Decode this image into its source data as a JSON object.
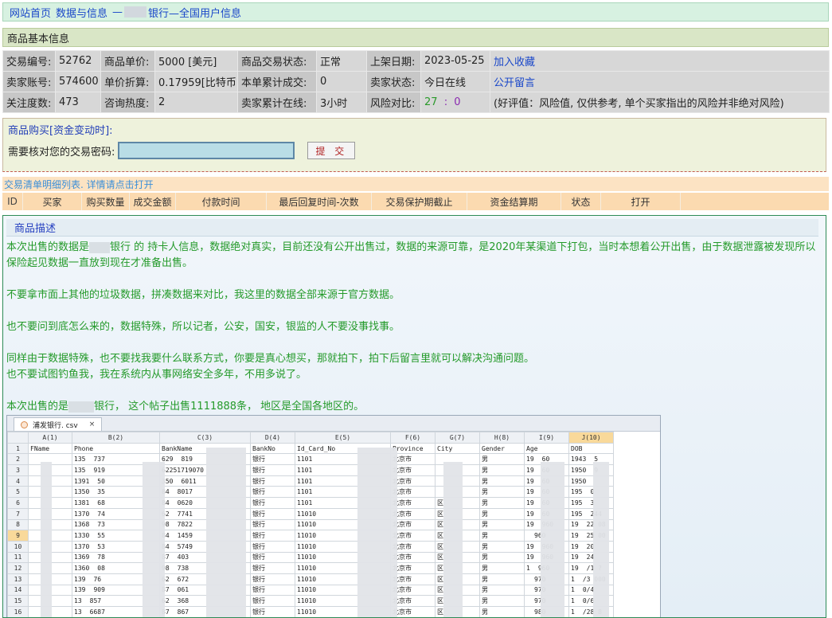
{
  "breadcrumb": {
    "home": "网站首页",
    "section": "数据与信息",
    "sep": "—",
    "title_suffix": "银行—全国用户信息"
  },
  "basic_info": {
    "heading": "商品基本信息",
    "rows": [
      [
        {
          "label": "交易编号:",
          "value": "52762"
        },
        {
          "label": "商品单价:",
          "value": "5000 [美元]"
        },
        {
          "label": "商品交易状态:",
          "value": "正常"
        },
        {
          "label": "上架日期:",
          "value": "2023-05-25"
        },
        {
          "link": "加入收藏"
        }
      ],
      [
        {
          "label": "卖家账号:",
          "value": "574600"
        },
        {
          "label": "单价折算:",
          "value": "0.17959[比特币]"
        },
        {
          "label": "本单累计成交:",
          "value": "0"
        },
        {
          "label": "卖家状态:",
          "value": "今日在线"
        },
        {
          "link": "公开留言"
        }
      ],
      [
        {
          "label": "关注度数:",
          "value": "473"
        },
        {
          "label": "咨询热度:",
          "value": "2"
        },
        {
          "label": "卖家累计在线:",
          "value": "3小时"
        },
        {
          "label": "风险对比:",
          "value_a": "27",
          "value_sep": ":",
          "value_b": "0"
        },
        {
          "note": "(好评值：风险值, 仅供参考, 单个买家指出的风险并非绝对风险)"
        }
      ]
    ]
  },
  "purchase": {
    "title": "商品购买[资金变动时]:",
    "password_label": "需要核对您的交易密码:",
    "password_value": "",
    "submit_label": "提 交"
  },
  "orders": {
    "title": "交易清单明细列表. 详情请点击打开",
    "columns": [
      "ID",
      "买家",
      "购买数量",
      "成交金额",
      "付款时间",
      "最后回复时间-次数",
      "交易保护期截止",
      "资金结算期",
      "状态",
      "打开"
    ]
  },
  "description": {
    "tag": "商品描述",
    "paragraphs": [
      "本次出售的数据是",
      "银行 的 持卡人信息，数据绝对真实，目前还没有公开出售过，数据的来源可靠，是2020年某渠道下打包，当时本想着公开出售，由于数据泄露被发现所以保险起见数据一直放到现在才准备出售。",
      "不要拿市面上其他的垃圾数据，拼凑数据来对比，我这里的数据全部来源于官方数据。",
      "也不要问到底怎么来的，数据特殊，所以记者，公安，国安，银监的人不要没事找事。",
      "同样由于数据特殊，也不要找我要什么联系方式，你要是真心想买，那就拍下，拍下后留言里就可以解决沟通问题。",
      "也不要试图钓鱼我，我在系统内从事网络安全多年，不用多说了。",
      "本次出售的是",
      "银行， 这个帖子出售1111888条， 地区是全国各地区的。"
    ]
  },
  "sheet": {
    "tab_name": "浦发银行. csv",
    "tab_close": "×",
    "columns": [
      "A(1)",
      "B(2)",
      "C(3)",
      "D(4)",
      "E(5)",
      "F(6)",
      "G(7)",
      "H(8)",
      "I(9)",
      "J(10)"
    ],
    "header_row": [
      "FName",
      "Phone",
      "BankName",
      "BankNo",
      "Id_Card_No",
      "Province",
      "City",
      "Gender",
      "Age",
      "DOB"
    ],
    "rows": [
      {
        "n": "2",
        "b": "135",
        "b2": "737",
        "c": "629",
        "c2": "819",
        "d": "银行",
        "e": "1101",
        "f": "北京市",
        "g": "",
        "h": "男",
        "i": "19",
        "i2": "60",
        "j": "1943",
        "j2": "5"
      },
      {
        "n": "3",
        "b": "135",
        "b2": "919",
        "c": "62251719070",
        "c2": "",
        "d": "银行",
        "e": "1101",
        "f": "北京市",
        "g": "",
        "h": "男",
        "i": "19",
        "i2": "60",
        "j": "1950",
        "j2": "9"
      },
      {
        "n": "4",
        "b": "1391",
        "b2": "50",
        "c": "350",
        "c2": "6011",
        "d": "银行",
        "e": "1101",
        "f": "北京市",
        "g": "",
        "h": "男",
        "i": "19",
        "i2": "60",
        "j": "1950",
        "j2": ""
      },
      {
        "n": "5",
        "b": "1350",
        "b2": "35",
        "c": "84",
        "c2": "8017",
        "d": "银行",
        "e": "1101",
        "f": "北京市",
        "g": "",
        "h": "男",
        "i": "19",
        "i2": "60",
        "j": "195",
        "j2": "0"
      },
      {
        "n": "6",
        "b": "1381",
        "b2": "68",
        "c": "84",
        "c2": "0620",
        "d": "银行",
        "e": "1101",
        "f": "北京市",
        "g": "区",
        "h": "男",
        "i": "19",
        "i2": "60",
        "j": "195",
        "j2": "3"
      },
      {
        "n": "7",
        "b": "1370",
        "b2": "74",
        "c": "62",
        "c2": "7741",
        "d": "银行",
        "e": "11010",
        "f": "北京市",
        "g": "区",
        "h": "男",
        "i": "19",
        "i2": "60",
        "j": "195",
        "j2": "244"
      },
      {
        "n": "8",
        "b": "1368",
        "b2": "73",
        "c": "98",
        "c2": "7822",
        "d": "银行",
        "e": "11010",
        "f": "北京市",
        "g": "区",
        "h": "男",
        "i": "19",
        "i2": "960",
        "j": "19",
        "j2": "22 08"
      },
      {
        "n": "9",
        "b": "1330",
        "b2": "55",
        "c": "84",
        "c2": "1459",
        "d": "银行",
        "e": "11010",
        "f": "北京市",
        "g": "区",
        "h": "男",
        "i": "",
        "i2": "960",
        "j": "19",
        "j2": "25 00"
      },
      {
        "n": "10",
        "b": "1370",
        "b2": "53",
        "c": "84",
        "c2": "5749",
        "d": "银行",
        "e": "11010",
        "f": "北京市",
        "g": "区",
        "h": "男",
        "i": "19",
        "i2": "960",
        "j": "19",
        "j2": "20"
      },
      {
        "n": "11",
        "b": "1369",
        "b2": "78",
        "c": "87",
        "c2": "403",
        "d": "银行",
        "e": "11010",
        "f": "北京市",
        "g": "区",
        "h": "男",
        "i": "19",
        "i2": "960",
        "j": "19",
        "j2": "24"
      },
      {
        "n": "12",
        "b": "1360",
        "b2": "08",
        "c": "98",
        "c2": "738",
        "d": "银行",
        "e": "11010",
        "f": "北京市",
        "g": "区",
        "h": "男",
        "i": "1",
        "i2": "960",
        "j": "19",
        "j2": "/1 ?"
      },
      {
        "n": "13",
        "b": "139",
        "b2": "76",
        "c": "62",
        "c2": "672",
        "d": "银行",
        "e": "11010",
        "f": "北京市",
        "g": "区",
        "h": "男",
        "i": "",
        "i2": "970",
        "j": "1",
        "j2": "/3 000"
      },
      {
        "n": "14",
        "b": "139",
        "b2": "909",
        "c": "87",
        "c2": "061",
        "d": "银行",
        "e": "11010",
        "f": "北京市",
        "g": "区",
        "h": "男",
        "i": "",
        "i2": "970",
        "j": "1",
        "j2": "0/4"
      },
      {
        "n": "15",
        "b": "13",
        "b2": "857",
        "c": "62",
        "c2": "368",
        "d": "银行",
        "e": "11010",
        "f": "北京市",
        "g": "区",
        "h": "男",
        "i": "",
        "i2": "970",
        "j": "1",
        "j2": "0/6"
      },
      {
        "n": "16",
        "b": "13",
        "b2": "6687",
        "c": "87",
        "c2": "867",
        "d": "银行",
        "e": "11010",
        "f": "北京市",
        "g": "区",
        "h": "男",
        "i": "",
        "i2": "980",
        "j": "1",
        "j2": "/28 8"
      }
    ]
  }
}
